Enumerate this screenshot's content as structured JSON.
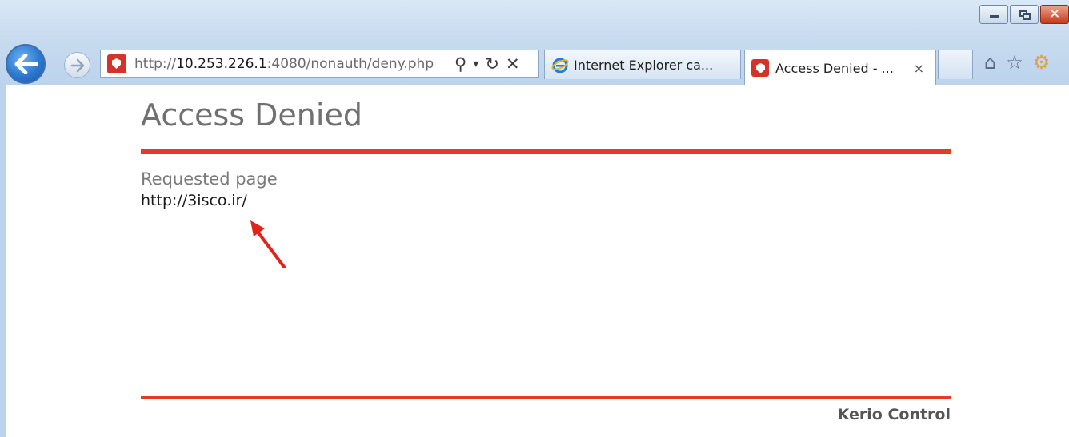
{
  "browser": {
    "address_url_dim": "http://",
    "address_url_host": "10.253.226.1",
    "address_url_rest": ":4080/nonauth/deny.php",
    "search_glyph": "⚲",
    "dropdown_glyph": "▾",
    "refresh_glyph": "↻",
    "stop_glyph": "✕",
    "tabs": [
      {
        "label": "Internet Explorer ca...",
        "icon": "ie-icon",
        "active": false
      },
      {
        "label": "Access Denied - ...",
        "icon": "kerio-favicon-icon",
        "active": true,
        "close": "×"
      }
    ],
    "toolbar_icons": {
      "home": "⌂",
      "favorites": "☆",
      "tools": "⚙"
    }
  },
  "page": {
    "title": "Access Denied",
    "requested_label": "Requested page",
    "requested_url": "http://3isco.ir/",
    "footer_brand": "Kerio Control"
  },
  "colors": {
    "accent_red": "#e33a2a",
    "title_gray": "#707070",
    "chrome_blue": "#bcd3ec"
  }
}
